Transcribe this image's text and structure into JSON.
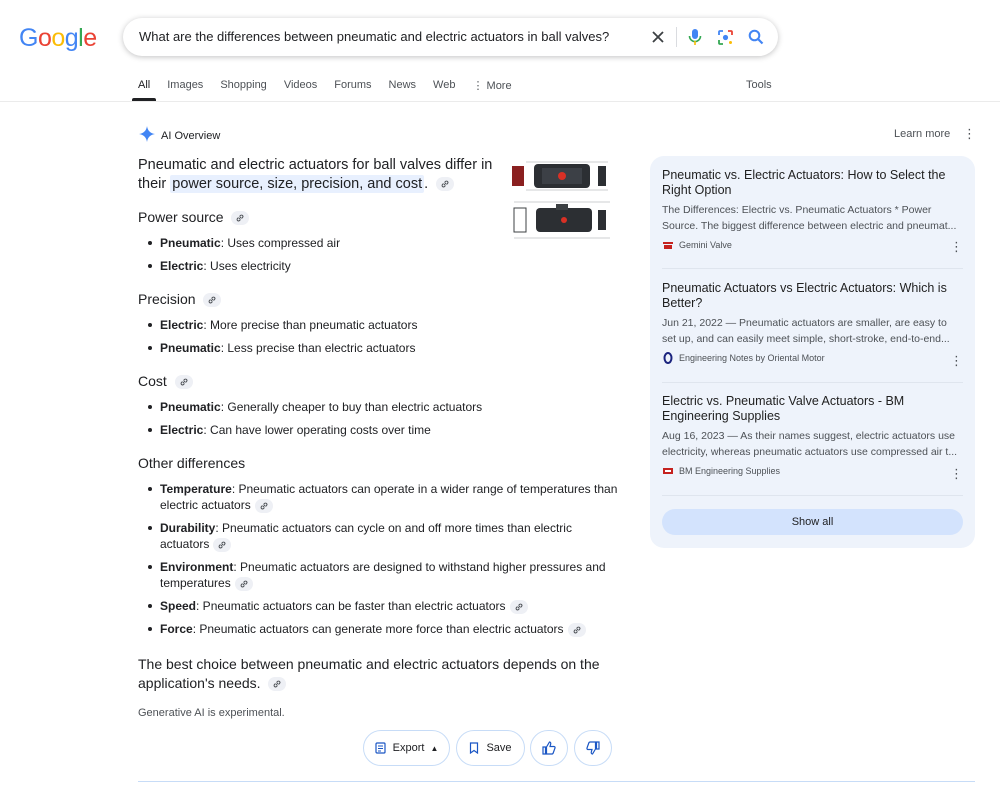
{
  "logo": {
    "l1": "G",
    "l2": "o",
    "l3": "o",
    "l4": "g",
    "l5": "l",
    "l6": "e"
  },
  "search": {
    "query": "What are the differences between pneumatic and electric actuators in ball valves?"
  },
  "tabs": [
    {
      "label": "All"
    },
    {
      "label": "Images"
    },
    {
      "label": "Shopping"
    },
    {
      "label": "Videos"
    },
    {
      "label": "Forums"
    },
    {
      "label": "News"
    },
    {
      "label": "Web"
    },
    {
      "label": "More"
    }
  ],
  "tools_label": "Tools",
  "ai_overview": {
    "label": "AI Overview",
    "learn_more": "Learn more",
    "intro_text": "Pneumatic and electric actuators for ball valves differ in their",
    "intro_highlight": "power source, size, precision, and cost",
    "intro_end": ".",
    "sections": [
      {
        "heading": "Power source",
        "items": [
          {
            "term": "Pneumatic",
            "text": ": Uses compressed air"
          },
          {
            "term": "Electric",
            "text": ": Uses electricity"
          }
        ]
      },
      {
        "heading": "Precision",
        "items": [
          {
            "term": "Electric",
            "text": ": More precise than pneumatic actuators"
          },
          {
            "term": "Pneumatic",
            "text": ": Less precise than electric actuators"
          }
        ]
      },
      {
        "heading": "Cost",
        "items": [
          {
            "term": "Pneumatic",
            "text": ": Generally cheaper to buy than electric actuators"
          },
          {
            "term": "Electric",
            "text": ": Can have lower operating costs over time"
          }
        ]
      },
      {
        "heading": "Other differences",
        "items": [
          {
            "term": "Temperature",
            "text": ": Pneumatic actuators can operate in a wider range of temperatures than electric actuators"
          },
          {
            "term": "Durability",
            "text": ": Pneumatic actuators can cycle on and off more times than electric actuators"
          },
          {
            "term": "Environment",
            "text": ": Pneumatic actuators are designed to withstand higher pressures and temperatures"
          },
          {
            "term": "Speed",
            "text": ": Pneumatic actuators can be faster than electric actuators"
          },
          {
            "term": "Force",
            "text": ": Pneumatic actuators can generate more force than electric actuators"
          }
        ]
      }
    ],
    "conclusion": "The best choice between pneumatic and electric actuators depends on the application's needs.",
    "disclaimer": "Generative AI is experimental.",
    "buttons": {
      "export": "Export",
      "save": "Save"
    }
  },
  "sources": [
    {
      "title": "Pneumatic vs. Electric Actuators: How to Select the Right Option",
      "desc": "The Differences: Electric vs. Pneumatic Actuators * Power Source. The biggest difference between electric and pneumat...",
      "site": "Gemini Valve"
    },
    {
      "title": "Pneumatic Actuators vs Electric Actuators: Which is Better?",
      "desc": "Jun 21, 2022 — Pneumatic actuators are smaller, are easy to set up, and can easily meet simple, short-stroke, end-to-end...",
      "site": "Engineering Notes by Oriental Motor"
    },
    {
      "title": "Electric vs. Pneumatic Valve Actuators - BM Engineering Supplies",
      "desc": "Aug 16, 2023 — As their names suggest, electric actuators use electricity, whereas pneumatic actuators use compressed air t...",
      "site": "BM Engineering Supplies"
    }
  ],
  "show_all": "Show all"
}
